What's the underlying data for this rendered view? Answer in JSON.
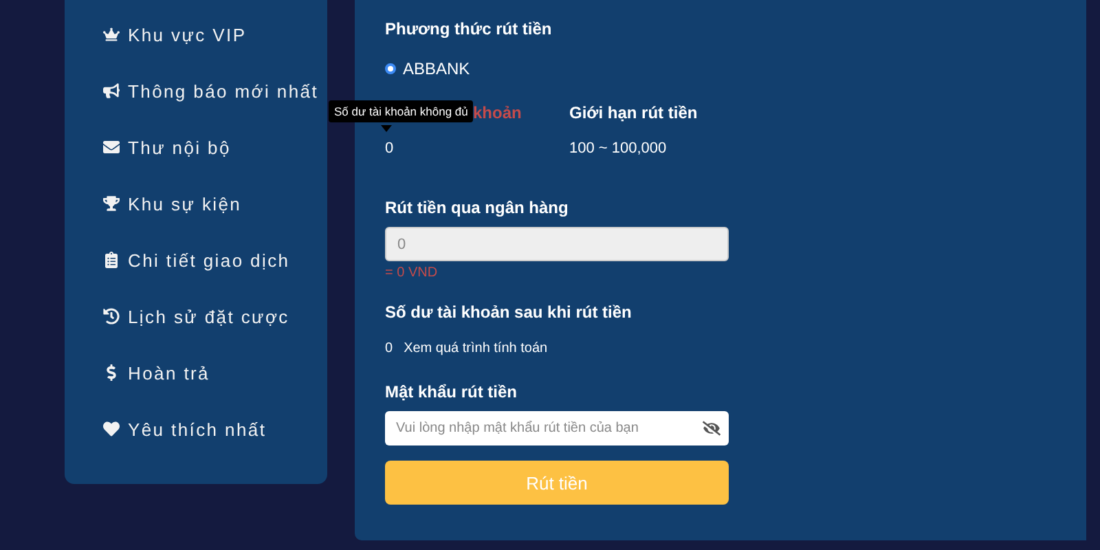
{
  "sidebar": {
    "items": [
      {
        "label": "Khu vực VIP"
      },
      {
        "label": "Thông báo mới nhất"
      },
      {
        "label": "Thư nội bộ"
      },
      {
        "label": "Khu sự kiện"
      },
      {
        "label": "Chi tiết giao dịch"
      },
      {
        "label": "Lịch sử đặt cược"
      },
      {
        "label": "Hoàn trả"
      },
      {
        "label": "Yêu thích nhất"
      }
    ]
  },
  "withdraw": {
    "method_title": "Phương thức rút tiền",
    "methods": [
      {
        "label": "ABBANK",
        "selected": true
      }
    ],
    "balance_label": "khoản",
    "balance_value": "0",
    "tooltip": "Số dư tài khoản không đủ",
    "limit_label": "Giới hạn rút tiền",
    "limit_value": "100 ~ 100,000",
    "amount_label": "Rút tiền qua ngân hàng",
    "amount_placeholder": "0",
    "amount_note": "= 0 VND",
    "after_label": "Số dư tài khoản sau khi rút tiền",
    "after_value": "0",
    "after_link": "Xem quá trình tính toán",
    "password_label": "Mật khẩu rút tiền",
    "password_placeholder": "Vui lòng nhập mật khẩu rút tiền của bạn",
    "submit": "Rút tiền"
  }
}
